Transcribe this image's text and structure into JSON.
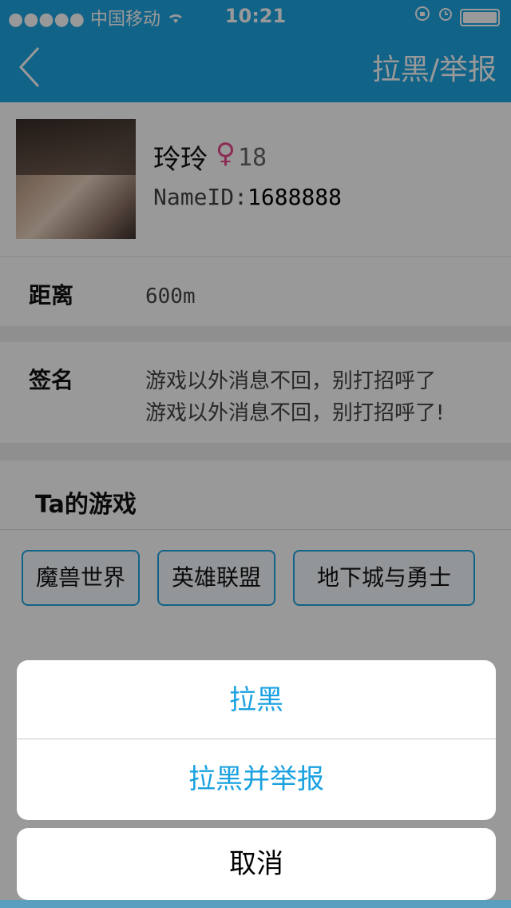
{
  "status_bar": {
    "signal": "●●●●●",
    "carrier": "中国移动",
    "wifi_icon": "wifi-icon",
    "time": "10:21",
    "icons": [
      "rotation-lock-icon",
      "alarm-icon",
      "battery-icon"
    ]
  },
  "nav": {
    "back_icon": "chevron-left-icon",
    "action": "拉黑/举报"
  },
  "profile": {
    "name": "玲玲",
    "gender_symbol": "♀",
    "age": "18",
    "nameid_label": "NameID:",
    "nameid_value": "1688888"
  },
  "distance": {
    "label": "距离",
    "value": "600m"
  },
  "signature": {
    "label": "签名",
    "line1": "游戏以外消息不回，别打招呼了",
    "line2": "游戏以外消息不回，别打招呼了!"
  },
  "games": {
    "title": "Ta的游戏",
    "tags": [
      "魔兽世界",
      "英雄联盟",
      "地下城与勇士"
    ]
  },
  "action_sheet": {
    "block": "拉黑",
    "block_report": "拉黑并举报",
    "cancel": "取消"
  },
  "colors": {
    "accent": "#1ea6e3",
    "sheet_text": "#1aa1e0",
    "gender": "#e8478a"
  }
}
